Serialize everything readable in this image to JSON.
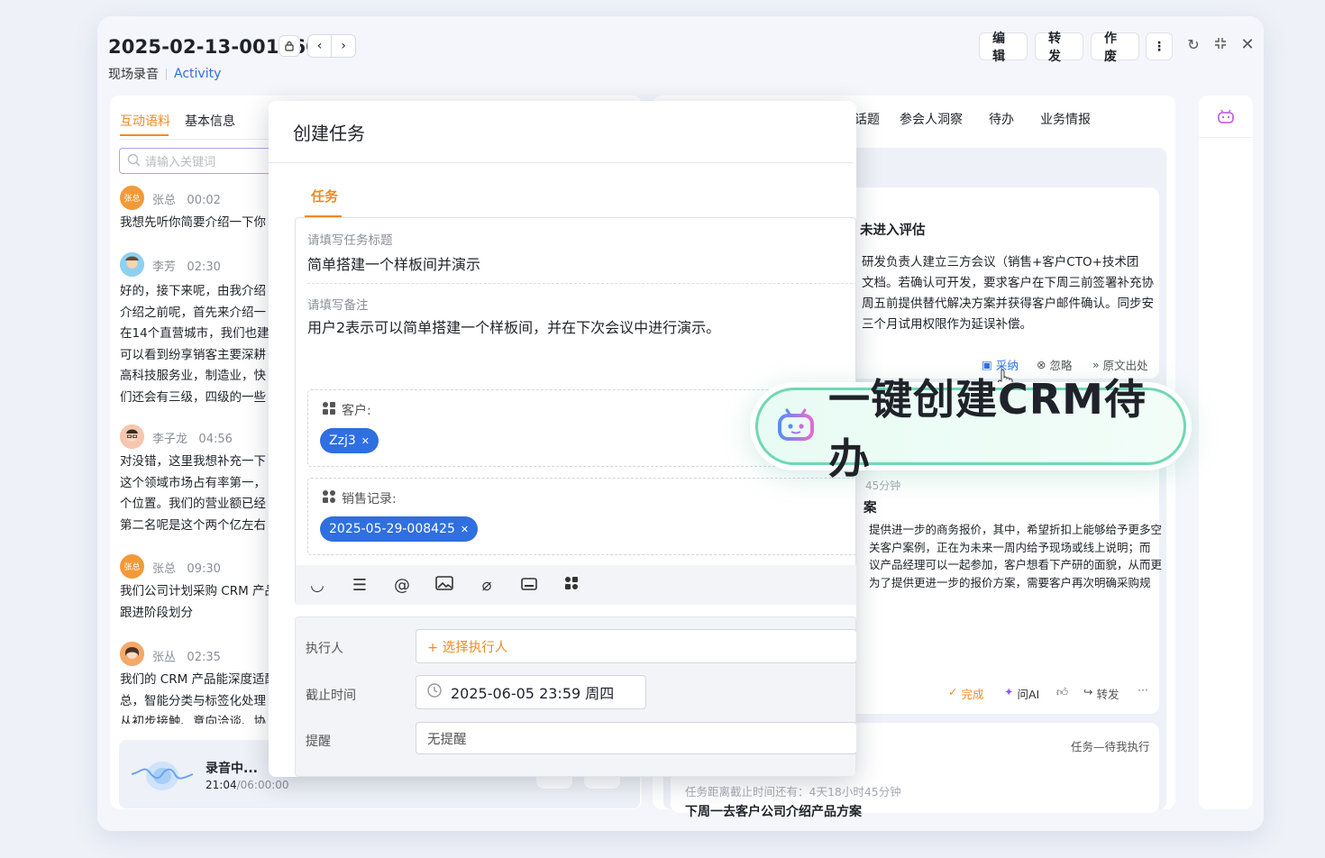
{
  "header": {
    "record_id": "2025-02-13-001960",
    "type_label": "现场录音",
    "activity_link": "Activity",
    "buttons": {
      "edit": "编辑",
      "forward": "转发",
      "void": "作废"
    }
  },
  "left": {
    "tabs": [
      "互动语料",
      "基本信息"
    ],
    "search_placeholder": "请输入关键词",
    "messages": [
      {
        "name": "张总",
        "time": "00:02",
        "avatar": "张总",
        "lines": [
          "我想先听你简要介绍一下你"
        ]
      },
      {
        "name": "李芳",
        "time": "02:30",
        "lines": [
          "好的，接下来呢，由我介绍",
          "介绍之前呢，首先来介绍一",
          "在14个直营城市，我们也建",
          "可以看到纷享销客主要深耕",
          "高科技服务业，制造业，快",
          "们还会有三级，四级的一些"
        ]
      },
      {
        "name": "李子龙",
        "time": "04:56",
        "lines": [
          "对没错，这里我想补充一下",
          "这个领域市场占有率第一，",
          "个位置。我们的营业额已经",
          "第二名呢是这个两个亿左右"
        ]
      },
      {
        "name": "张总",
        "time": "09:30",
        "avatar": "张总",
        "lines": [
          "我们公司计划采购 CRM 产品",
          "跟进阶段划分"
        ]
      },
      {
        "name": "张丛",
        "time": "02:35",
        "lines": [
          "我们的 CRM 产品能深度适配",
          "总，智能分类与标签化处理",
          "从初步接触、意向洽谈、协"
        ]
      }
    ],
    "recording": {
      "label": "录音中...",
      "current": "21:04",
      "total": "/06:00:00"
    }
  },
  "right": {
    "tabs": [
      "话题",
      "参会人洞察",
      "待办",
      "业务情报"
    ],
    "card1": {
      "title": "未进入评估",
      "lines": [
        "研发负责人建立三方会议（销售+客户CTO+技术团",
        "文档。若确认可开发，要求客户在下周三前签署补充协",
        "周五前提供替代解决方案并获得客户邮件确认。同步安",
        "三个月试用权限作为延误补偿。"
      ],
      "actions": {
        "adopt": "采纳",
        "ignore": "忽略",
        "source": "原文出处"
      }
    },
    "card2": {
      "meta": "45分钟",
      "title": "案",
      "lines": [
        "提供进一步的商务报价，其中，希望折扣上能够给予更多空",
        "关客户案例，正在为未来一周内给予现场或线上说明；而",
        "议产品经理可以一起参加，客户想看下产研的面貌，从而更",
        "为了提供更进一步的报价方案，需要客户再次明确采购规"
      ],
      "actions": {
        "done": "完成",
        "ask_ai": "问AI",
        "forward": "转发",
        "more": "···"
      }
    },
    "card3": {
      "status": "任务—待我执行",
      "meta": "任务距离截止时间还有：4天18小时45分钟",
      "title": "下周一去客户公司介绍产品方案"
    }
  },
  "modal": {
    "title": "创建任务",
    "tab": "任务",
    "task_title_label": "请填写任务标题",
    "task_title_value": "简单搭建一个样板间并演示",
    "note_label": "请填写备注",
    "note_value": "用户2表示可以简单搭建一个样板间，并在下次会议中进行演示。",
    "customer_label": "客户:",
    "customer_chip": "Zzj3",
    "sales_label": "销售记录:",
    "sales_chip": "2025-05-29-008425",
    "assignee_label": "执行人",
    "assignee_placeholder": "+ 选择执行人",
    "deadline_label": "截止时间",
    "deadline_value": "2025-06-05 23:59 周四",
    "reminder_label": "提醒",
    "reminder_value": "无提醒"
  },
  "badge": {
    "text": "一键创建CRM待办"
  },
  "colors": {
    "accent": "#f08a24",
    "primary": "#2f6fe0",
    "badge_border": "#6fd8b4"
  }
}
